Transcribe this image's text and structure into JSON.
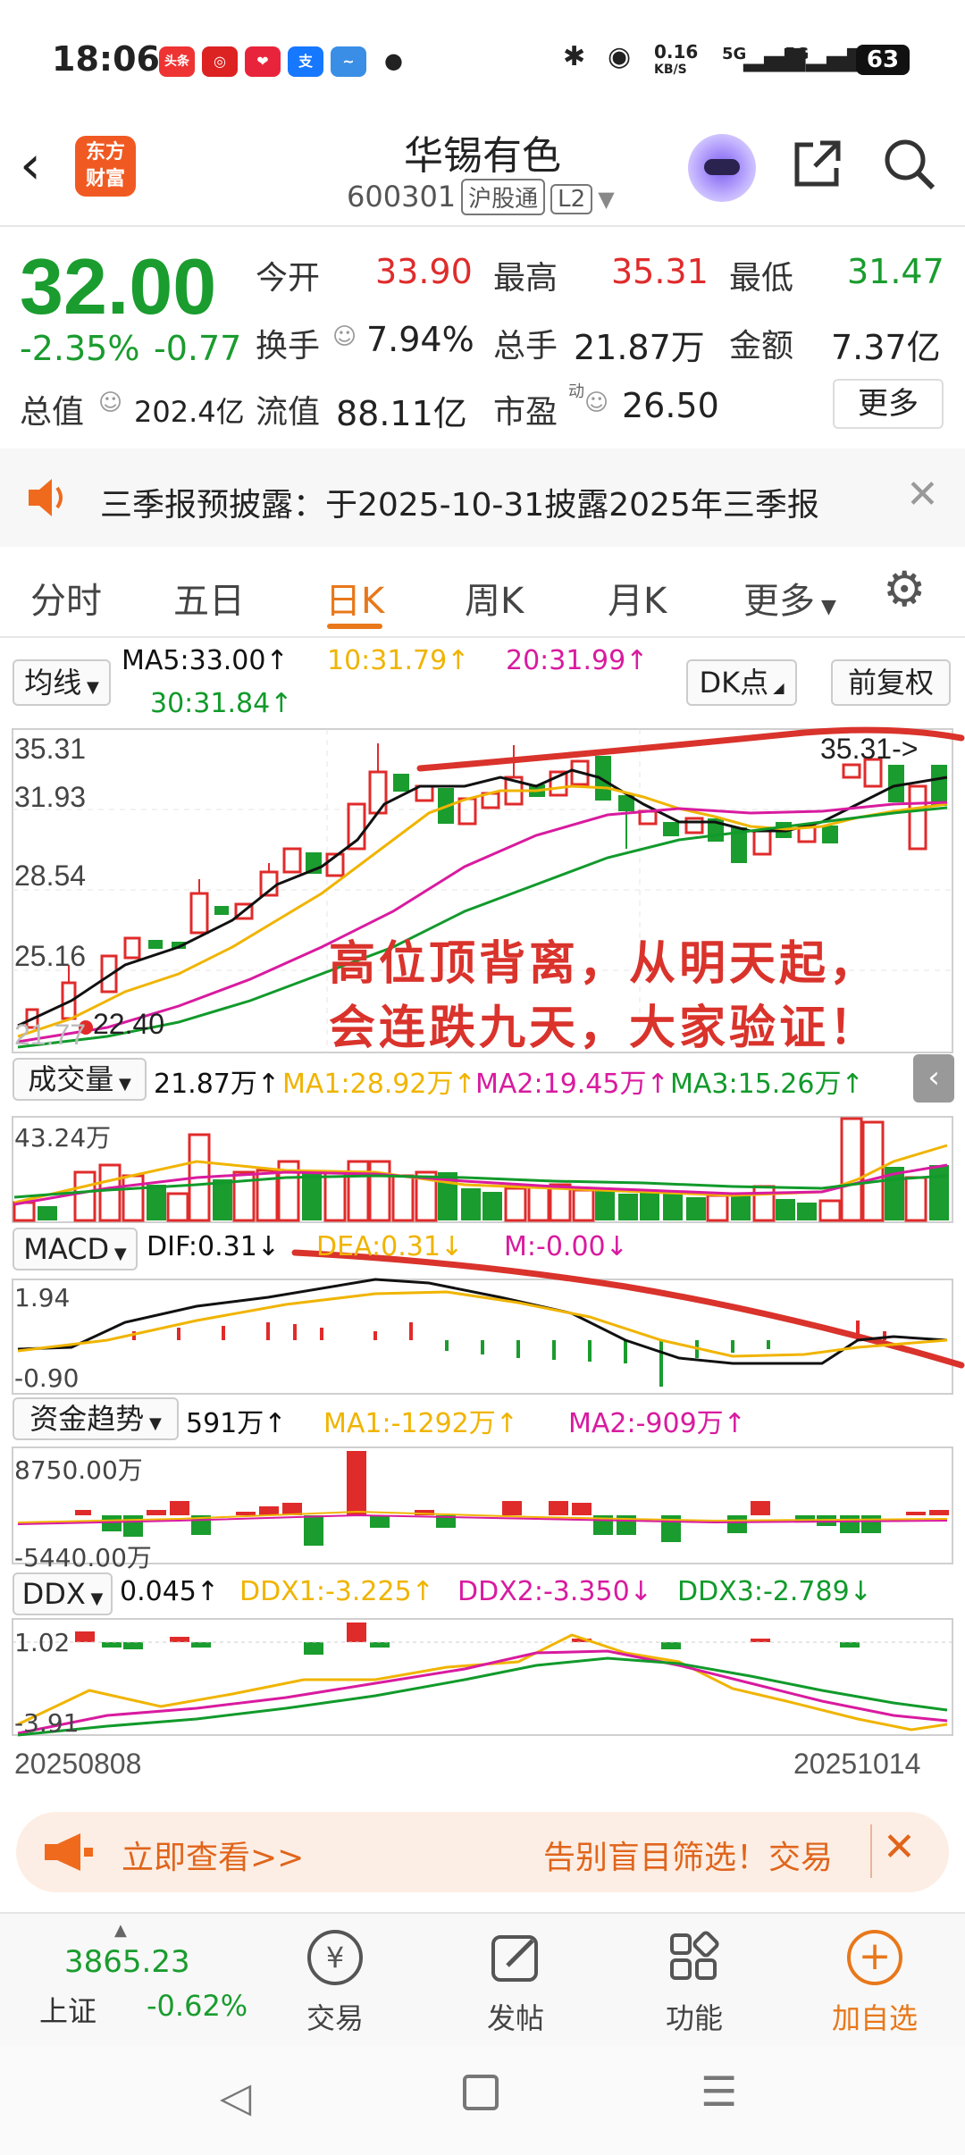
{
  "status_bar": {
    "time": "18:06",
    "net_speed": "0.16",
    "net_unit": "KB/S",
    "sig1": "5G",
    "sig2": "5G",
    "battery": "63",
    "app_toutiao": "头条"
  },
  "header": {
    "logo_line1": "东方",
    "logo_line2": "财富",
    "title": "华锡有色",
    "code": "600301",
    "tag1": "沪股通",
    "tag2": "L2"
  },
  "quote": {
    "price": "32.00",
    "change_pct": "-2.35%",
    "change": "-0.77",
    "open_label": "今开",
    "open": "33.90",
    "high_label": "最高",
    "high": "35.31",
    "low_label": "最低",
    "low": "31.47",
    "turnover_label": "换手",
    "turnover": "7.94%",
    "volume_label": "总手",
    "volume": "21.87万",
    "amount_label": "金额",
    "amount": "7.37亿",
    "mktcap_label": "总值",
    "mktcap": "202.4亿",
    "float_label": "流值",
    "float": "88.11亿",
    "pe_label": "市盈",
    "pe_sup": "动",
    "pe": "26.50",
    "more": "更多"
  },
  "notice": {
    "text": "三季报预披露：于2025-10-31披露2025年三季报"
  },
  "tabs": [
    "分时",
    "五日",
    "日K",
    "周K",
    "月K",
    "更多"
  ],
  "kline": {
    "ma_select": "均线",
    "ma5": "MA5:33.00↑",
    "ma10": "10:31.79↑",
    "ma20": "20:31.99↑",
    "ma30": "30:31.84↑",
    "dk_button": "DK点",
    "adjust_button": "前复权",
    "y_top": "35.31",
    "y2": "31.93",
    "y3": "28.54",
    "y4": "25.16",
    "y_low": "21.77",
    "high_marker": "35.31->",
    "low_marker": "22.40",
    "handwriting_line1": "高位顶背离，从明天起，",
    "handwriting_line2": "会连跌九天，大家验证！"
  },
  "volume": {
    "select": "成交量",
    "value": "21.87万↑",
    "ma1": "MA1:28.92万↑",
    "ma2": "MA2:19.45万↑",
    "ma3": "MA3:15.26万↑",
    "y_top": "43.24万"
  },
  "macd": {
    "select": "MACD",
    "dif": "DIF:0.31↓",
    "dea": "DEA:0.31↓",
    "m": "M:-0.00↓",
    "y_top": "1.94",
    "y_bottom": "-0.90"
  },
  "fund": {
    "select": "资金趋势",
    "value": "591万↑",
    "ma1": "MA1:-1292万↑",
    "ma2": "MA2:-909万↑",
    "y_top": "8750.00万",
    "y_bottom": "-5440.00万"
  },
  "ddx": {
    "select": "DDX",
    "value": "0.045↑",
    "ddx1": "DDX1:-3.225↑",
    "ddx2": "DDX2:-3.350↓",
    "ddx3": "DDX3:-2.789↓",
    "y_top": "1.02",
    "y_bottom": "-3.91"
  },
  "dates": {
    "start": "20250808",
    "end": "20251014"
  },
  "ad": {
    "cta": "立即查看>>",
    "text": "告别盲目筛选！交易"
  },
  "bottom_nav": {
    "index_value": "3865.23",
    "index_name": "上证",
    "index_change": "-0.62%",
    "trade": "交易",
    "post": "发帖",
    "function": "功能",
    "add_watch": "加自选"
  },
  "colors": {
    "up": "#e02b2b",
    "down": "#1a9c2e",
    "accent": "#e8781a",
    "ma5": "#111111",
    "ma10": "#f0b400",
    "ma20": "#d81b9f",
    "ma30": "#119a2b"
  }
}
